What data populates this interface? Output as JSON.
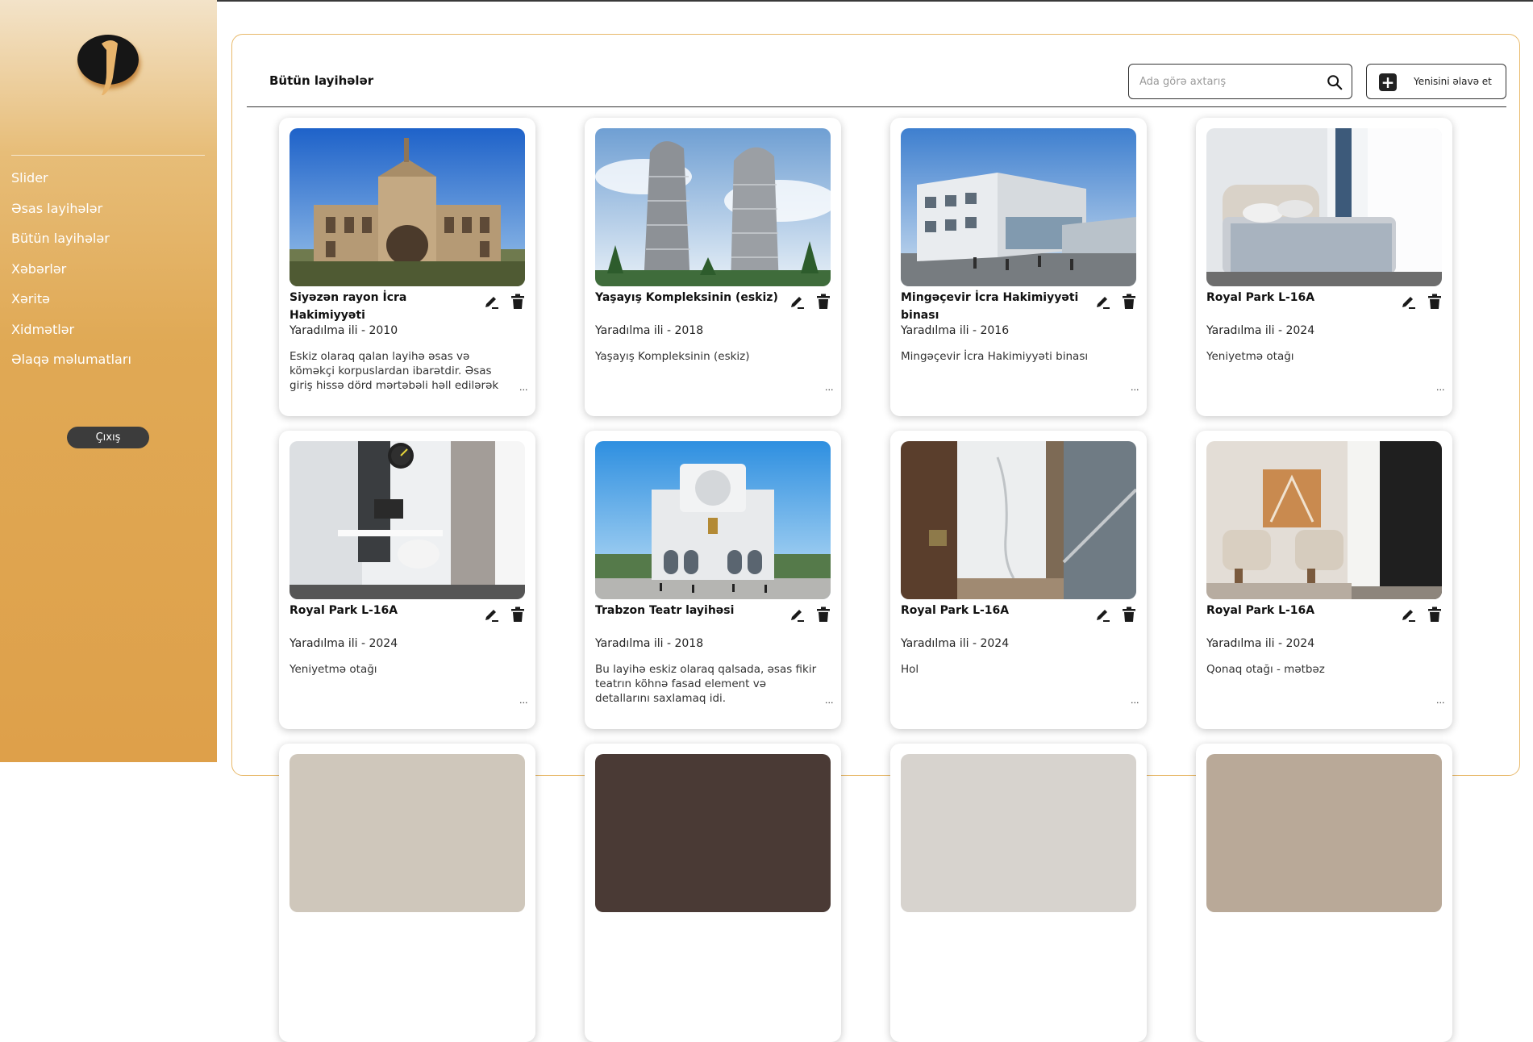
{
  "sidebar": {
    "logo_icon": "brand-logo",
    "items": [
      {
        "label": "Slider"
      },
      {
        "label": "Əsas layihələr"
      },
      {
        "label": "Bütün layihələr"
      },
      {
        "label": "Xəbərlər"
      },
      {
        "label": "Xəritə"
      },
      {
        "label": "Xidmətlər"
      },
      {
        "label": "Əlaqə məlumatları"
      }
    ],
    "logout_label": "Çıxış"
  },
  "header": {
    "title": "Bütün layihələr",
    "search_placeholder": "Ada görə axtarış",
    "add_label": "Yenisini əlavə et"
  },
  "colors": {
    "sidebar_top": "#f3e3c9",
    "sidebar_bottom": "#dea04a",
    "panel_border": "#e8b96a",
    "logout_bg": "#3c3c3c"
  },
  "projects": [
    {
      "title": "Siyəzən rayon İcra Hakimiyyəti",
      "year": "Yaradılma ili - 2010",
      "desc": "Eskiz olaraq qalan layihə əsas və köməkçi korpuslardan ibarətdir. Əsas giriş hissə dörd mərtəbəli həll edilərək",
      "more": "...",
      "image": "palace-building"
    },
    {
      "title": "Yaşayış Kompleksinin (eskiz)",
      "year": "Yaradılma ili - 2018",
      "desc": "Yaşayış Kompleksinin (eskiz)",
      "more": "...",
      "image": "twin-towers"
    },
    {
      "title": "Mingəçevir İcra Hakimiyyəti binası",
      "year": "Yaradılma ili - 2016",
      "desc": "Mingəçevir İcra Hakimiyyəti binası",
      "more": "...",
      "image": "modern-office"
    },
    {
      "title": "Royal Park L-16A",
      "year": "Yaradılma ili - 2024",
      "desc": "Yeniyetmə otağı",
      "more": "...",
      "image": "bedroom"
    },
    {
      "title": "Royal Park L-16A",
      "year": "Yaradılma ili - 2024",
      "desc": "Yeniyetmə otağı",
      "more": "...",
      "image": "study-room"
    },
    {
      "title": "Trabzon Teatr layihəsi",
      "year": "Yaradılma ili - 2018",
      "desc": "Bu layihə eskiz olaraq qalsada, əsas fikir teatrın köhnə fasad element və detallarını saxlamaq idi.",
      "more": "...",
      "image": "theatre"
    },
    {
      "title": "Royal Park L-16A",
      "year": "Yaradılma ili - 2024",
      "desc": "Hol",
      "more": "...",
      "image": "hallway"
    },
    {
      "title": "Royal Park L-16A",
      "year": "Yaradılma ili - 2024",
      "desc": "Qonaq otağı - mətbəz",
      "more": "...",
      "image": "living-room"
    }
  ]
}
